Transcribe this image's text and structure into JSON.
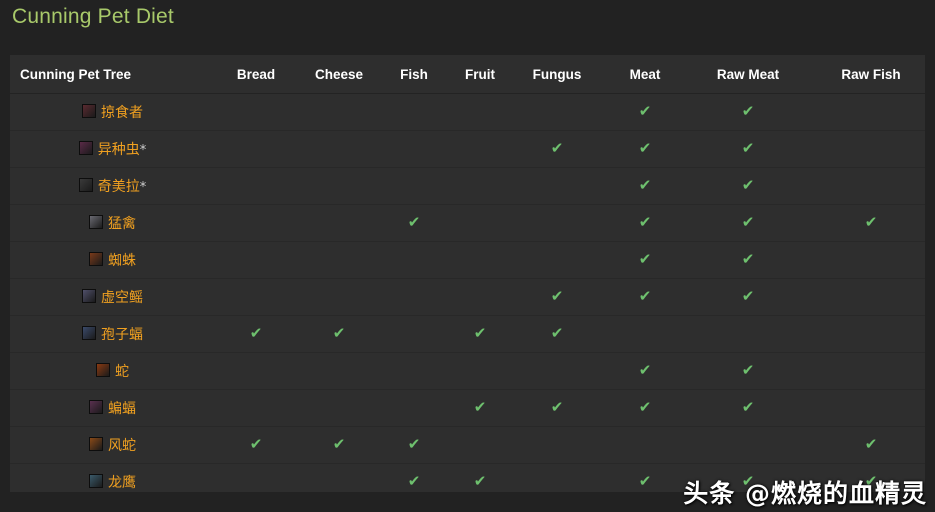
{
  "page": {
    "title": "Cunning Pet Diet",
    "title_color": "#a8c96a",
    "background_color": "#222222",
    "table_background_color": "#2e2e2e"
  },
  "watermark": {
    "text": "头条 @燃烧的血精灵"
  },
  "table": {
    "columns": [
      {
        "key": "name",
        "label": "Cunning Pet Tree"
      },
      {
        "key": "bread",
        "label": "Bread"
      },
      {
        "key": "cheese",
        "label": "Cheese"
      },
      {
        "key": "fish",
        "label": "Fish"
      },
      {
        "key": "fruit",
        "label": "Fruit"
      },
      {
        "key": "fungus",
        "label": "Fungus"
      },
      {
        "key": "meat",
        "label": "Meat"
      },
      {
        "key": "raw_meat",
        "label": "Raw Meat"
      },
      {
        "key": "raw_fish",
        "label": "Raw Fish"
      }
    ],
    "check_glyph": "✔",
    "check_color": "#6ec06e",
    "rows": [
      {
        "name": "掠食者",
        "icon": "pet-icon-raptor",
        "icon_color": "#5a2a30",
        "cells": [
          "",
          "",
          "",
          "",
          "",
          "✔",
          "✔",
          ""
        ]
      },
      {
        "name": "异种虫*",
        "icon": "pet-icon-silithid",
        "icon_color": "#5a2a48",
        "cells": [
          "",
          "",
          "",
          "",
          "✔",
          "✔",
          "✔",
          ""
        ]
      },
      {
        "name": "奇美拉*",
        "icon": "pet-icon-chimaera",
        "icon_color": "#3a3a3a",
        "cells": [
          "",
          "",
          "",
          "",
          "",
          "✔",
          "✔",
          ""
        ]
      },
      {
        "name": "猛禽",
        "icon": "pet-icon-bird-of-prey",
        "icon_color": "#6a6a72",
        "cells": [
          "",
          "",
          "✔",
          "",
          "",
          "✔",
          "✔",
          "✔"
        ]
      },
      {
        "name": "蜘蛛",
        "icon": "pet-icon-spider",
        "icon_color": "#7a3a1a",
        "cells": [
          "",
          "",
          "",
          "",
          "",
          "✔",
          "✔",
          ""
        ]
      },
      {
        "name": "虚空鳐",
        "icon": "pet-icon-nether-ray",
        "icon_color": "#50506a",
        "cells": [
          "",
          "",
          "",
          "",
          "✔",
          "✔",
          "✔",
          ""
        ]
      },
      {
        "name": "孢子蝠",
        "icon": "pet-icon-sporebat",
        "icon_color": "#3a4a6a",
        "cells": [
          "✔",
          "✔",
          "",
          "✔",
          "✔",
          "",
          "",
          ""
        ]
      },
      {
        "name": "蛇",
        "icon": "pet-icon-serpent",
        "icon_color": "#8a3a12",
        "cells": [
          "",
          "",
          "",
          "",
          "",
          "✔",
          "✔",
          ""
        ]
      },
      {
        "name": "蝙蝠",
        "icon": "pet-icon-bat",
        "icon_color": "#5a3050",
        "cells": [
          "",
          "",
          "",
          "✔",
          "✔",
          "✔",
          "✔",
          ""
        ]
      },
      {
        "name": "风蛇",
        "icon": "pet-icon-wind-serpent",
        "icon_color": "#8a4a18",
        "cells": [
          "✔",
          "✔",
          "✔",
          "",
          "",
          "",
          "",
          "✔"
        ]
      },
      {
        "name": "龙鹰",
        "icon": "pet-icon-dragonhawk",
        "icon_color": "#3a5a6a",
        "cells": [
          "",
          "",
          "✔",
          "✔",
          "",
          "✔",
          "✔",
          "✔"
        ]
      }
    ]
  }
}
